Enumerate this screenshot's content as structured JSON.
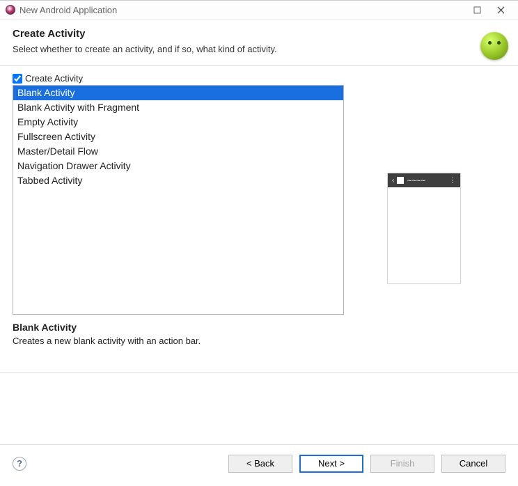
{
  "window": {
    "title": "New Android Application"
  },
  "header": {
    "title": "Create Activity",
    "subtitle": "Select whether to create an activity, and if so, what kind of activity."
  },
  "checkbox": {
    "label": "Create Activity",
    "checked": true
  },
  "activity_list": {
    "items": [
      "Blank Activity",
      "Blank Activity with Fragment",
      "Empty Activity",
      "Fullscreen Activity",
      "Master/Detail Flow",
      "Navigation Drawer Activity",
      "Tabbed Activity"
    ],
    "selected_index": 0
  },
  "description": {
    "title": "Blank Activity",
    "text": "Creates a new blank activity with an action bar."
  },
  "buttons": {
    "back": "< Back",
    "next": "Next >",
    "finish": "Finish",
    "cancel": "Cancel"
  }
}
